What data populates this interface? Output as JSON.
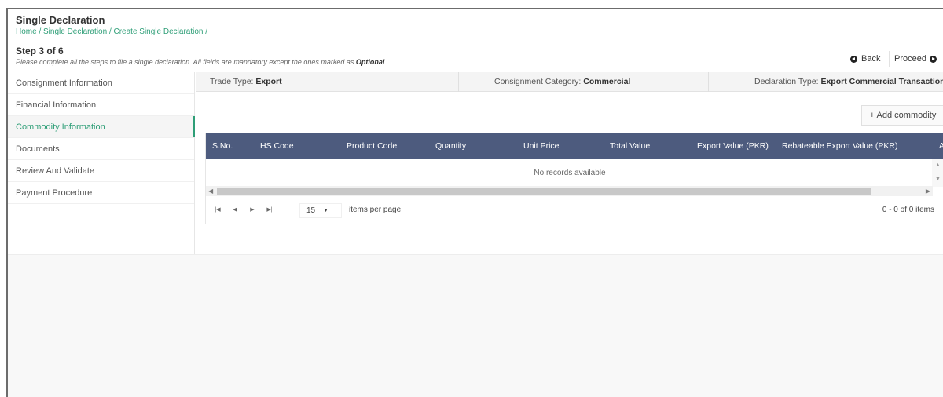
{
  "header": {
    "title": "Single Declaration",
    "breadcrumb": "Home / Single Declaration / Create Single Declaration /",
    "step": "Step 3 of 6",
    "description_main": "Please complete all the steps to file a single declaration. All fields are mandatory except the ones marked as ",
    "description_emphasis": "Optional",
    "description_end": ".",
    "back_label": "Back",
    "proceed_label": "Proceed"
  },
  "sidebar": {
    "items": [
      {
        "label": "Consignment Information",
        "active": false
      },
      {
        "label": "Financial Information",
        "active": false
      },
      {
        "label": "Commodity Information",
        "active": true
      },
      {
        "label": "Documents",
        "active": false
      },
      {
        "label": "Review And Validate",
        "active": false
      },
      {
        "label": "Payment Procedure",
        "active": false
      }
    ]
  },
  "info_bar": {
    "trade_type_label": "Trade Type: ",
    "trade_type_value": "Export",
    "consignment_category_label": "Consignment Category: ",
    "consignment_category_value": "Commercial",
    "declaration_type_label": "Declaration Type: ",
    "declaration_type_value": "Export Commercial Transaction"
  },
  "add_commodity_label": "+ Add commodity",
  "grid": {
    "columns": [
      "S.No.",
      "HS Code",
      "Product Code",
      "Quantity",
      "Unit Price",
      "Total Value",
      "Export Value (PKR)",
      "Rebateable Export Value (PKR)",
      "A"
    ],
    "empty_text": "No records available"
  },
  "pager": {
    "page_size": "15",
    "items_per_page_label": "items per page",
    "count_text": "0 - 0 of 0 items"
  },
  "colors": {
    "accent": "#2e9e77",
    "grid_header": "#4d5b7e"
  }
}
